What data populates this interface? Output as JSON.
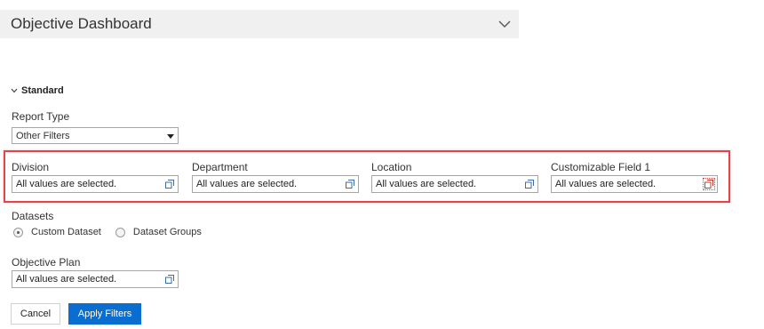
{
  "header": {
    "title": "Objective Dashboard"
  },
  "section": {
    "title": "Standard"
  },
  "report_type": {
    "label": "Report Type",
    "value": "Other Filters"
  },
  "filters": [
    {
      "label": "Division",
      "value": "All values are selected."
    },
    {
      "label": "Department",
      "value": "All values are selected."
    },
    {
      "label": "Location",
      "value": "All values are selected."
    },
    {
      "label": "Customizable Field 1",
      "value": "All values are selected."
    }
  ],
  "datasets": {
    "label": "Datasets",
    "options": [
      {
        "label": "Custom Dataset",
        "checked": true
      },
      {
        "label": "Dataset Groups",
        "checked": false
      }
    ]
  },
  "objective_plan": {
    "label": "Objective Plan",
    "value": "All values are selected."
  },
  "buttons": {
    "cancel": "Cancel",
    "apply": "Apply Filters"
  },
  "colors": {
    "primary": "#0a6ed1",
    "highlight": "#e0454a",
    "header_bg": "#f0f0f0"
  }
}
